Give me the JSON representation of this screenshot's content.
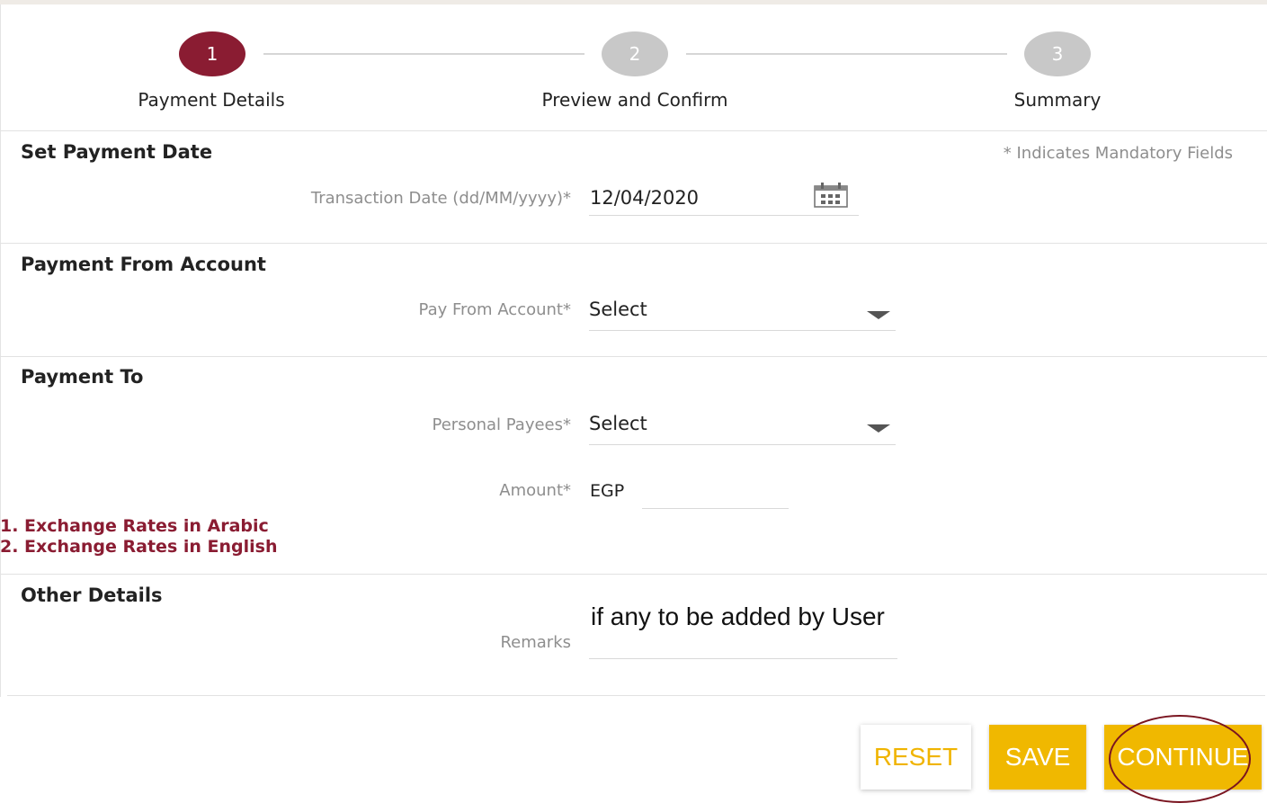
{
  "stepper": {
    "steps": [
      {
        "number": "1",
        "label": "Payment Details"
      },
      {
        "number": "2",
        "label": "Preview and Confirm"
      },
      {
        "number": "3",
        "label": "Summary"
      }
    ]
  },
  "mandatory_note": "* Indicates Mandatory Fields",
  "sections": {
    "payment_date": {
      "title": "Set Payment Date",
      "transaction_date_label": "Transaction Date (dd/MM/yyyy)*",
      "transaction_date_value": "12/04/2020"
    },
    "payment_from": {
      "title": "Payment From Account",
      "account_label": "Pay From Account*",
      "account_value": "Select"
    },
    "payment_to": {
      "title": "Payment To",
      "payee_label": "Personal Payees*",
      "payee_value": "Select",
      "amount_label": "Amount*",
      "currency": "EGP",
      "amount_value": ""
    },
    "exchange_links": [
      "1. Exchange Rates in Arabic",
      "2. Exchange Rates in English"
    ],
    "other_details": {
      "title": "Other Details",
      "remarks_label": "Remarks",
      "remarks_value": "if any to be added by User"
    }
  },
  "buttons": {
    "reset": "RESET",
    "save": "SAVE",
    "continue": "CONTINUE"
  },
  "colors": {
    "active_step": "#8a1c32",
    "inactive_step": "#c8c8c8",
    "button_accent": "#f0b800",
    "link": "#8a1c32"
  }
}
